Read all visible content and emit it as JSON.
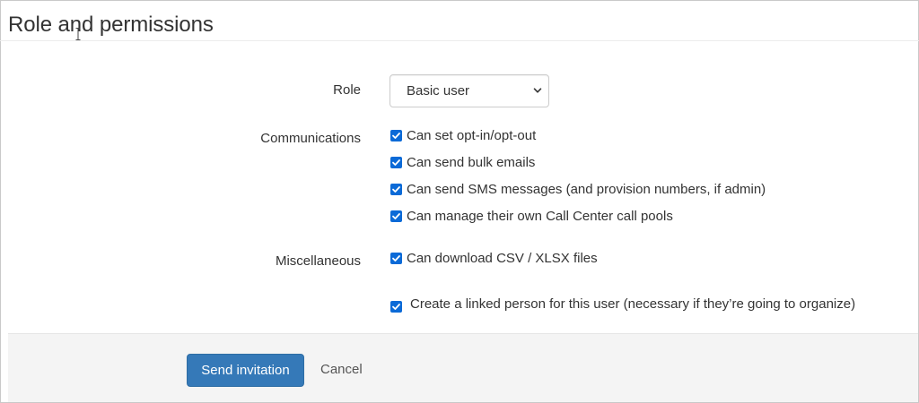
{
  "header": {
    "title": "Role and permissions"
  },
  "role": {
    "label": "Role",
    "selected": "Basic user"
  },
  "communications": {
    "label": "Communications",
    "options": [
      {
        "label": "Can set opt-in/opt-out",
        "checked": true
      },
      {
        "label": "Can send bulk emails",
        "checked": true
      },
      {
        "label": "Can send SMS messages (and provision numbers, if admin)",
        "checked": true
      },
      {
        "label": "Can manage their own Call Center call pools",
        "checked": true
      }
    ]
  },
  "miscellaneous": {
    "label": "Miscellaneous",
    "options": [
      {
        "label": "Can download CSV / XLSX files",
        "checked": true
      }
    ]
  },
  "linked_person": {
    "label": "Create a linked person for this user (necessary if they’re going to organize)",
    "checked": true
  },
  "footer": {
    "primary_label": "Send invitation",
    "cancel_label": "Cancel"
  },
  "colors": {
    "primary": "#3579b8",
    "checkbox": "#0b6ad7"
  },
  "icons": {
    "select_arrow": "chevron-down-icon",
    "checkbox_check": "check-icon"
  }
}
